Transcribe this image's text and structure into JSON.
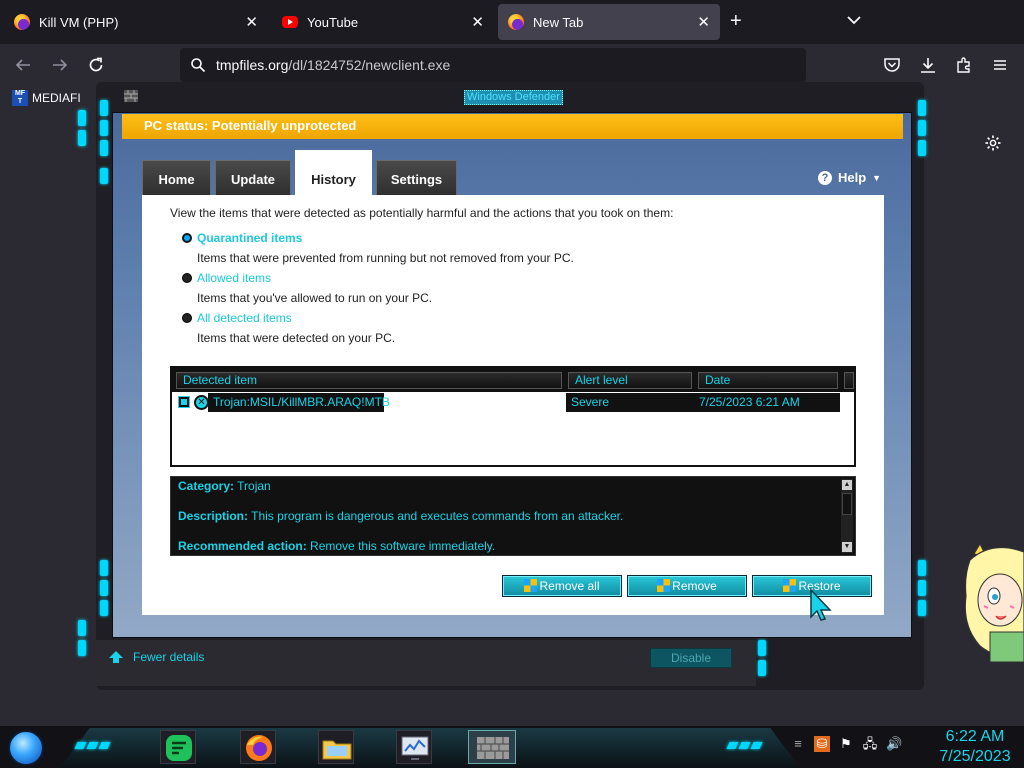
{
  "browser": {
    "tabs": [
      {
        "label": "Kill VM (PHP)",
        "icon": "firefox-icon",
        "active": false
      },
      {
        "label": "YouTube",
        "icon": "youtube-icon",
        "active": false
      },
      {
        "label": "New Tab",
        "icon": "firefox-icon",
        "active": true
      }
    ],
    "url_domain": "tmpfiles.org",
    "url_path": "/dl/1824752/newclient.exe",
    "bookmark": "MEDIAFI",
    "bookmark_icon_text": "MF T"
  },
  "defender": {
    "window_title": "Windows Defender",
    "status": "PC status: Potentially unprotected",
    "status_color": "#f5b100",
    "tabs": [
      {
        "label": "Home"
      },
      {
        "label": "Update"
      },
      {
        "label": "History"
      },
      {
        "label": "Settings"
      }
    ],
    "help_label": "Help",
    "intro": "View the items that were detected as potentially harmful and the actions that you took on them:",
    "options": [
      {
        "label": "Quarantined items",
        "desc": "Items that were prevented from running but not removed from your PC.",
        "selected": true
      },
      {
        "label": "Allowed items",
        "desc": "Items that you've allowed to run on your PC.",
        "selected": false
      },
      {
        "label": "All detected items",
        "desc": "Items that were detected on your PC.",
        "selected": false
      }
    ],
    "table": {
      "columns": [
        "Detected item",
        "Alert level",
        "Date"
      ],
      "rows": [
        {
          "item": "Trojan:MSIL/KillMBR.ARAQ!MTB",
          "alert": "Severe",
          "date": "7/25/2023 6:21 AM"
        }
      ]
    },
    "details": {
      "category_label": "Category:",
      "category_value": "Trojan",
      "description_label": "Description:",
      "description_value": "This program is dangerous and executes commands from an attacker.",
      "action_label": "Recommended action:",
      "action_value": "Remove this software immediately."
    },
    "buttons": {
      "remove_all": "Remove all",
      "remove": "Remove",
      "restore": "Restore"
    },
    "fewer_details": "Fewer details",
    "disable": "Disable",
    "accent": "#19d3e8"
  },
  "taskbar": {
    "time": "6:22 AM",
    "date": "7/25/2023"
  }
}
